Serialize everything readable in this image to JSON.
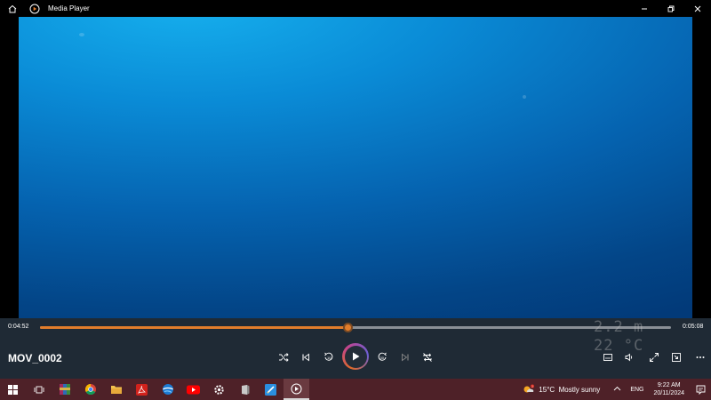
{
  "window": {
    "title": "Media Player"
  },
  "player": {
    "current_time": "0:04:52",
    "total_time": "0:05:08",
    "progress": 0.487,
    "file_name": "MOV_0002",
    "overlay_depth": "2.2 m",
    "overlay_temp": "22 °C"
  },
  "colors": {
    "accent": "#e27d2b",
    "video_top": "#16b0ee",
    "video_bottom": "#023a79",
    "taskbar": "#4e2128"
  },
  "taskbar": {
    "apps": [
      "start-icon",
      "task-view-icon",
      "winrar-icon",
      "chrome-icon",
      "file-explorer-icon",
      "acrobat-icon",
      "browser-icon",
      "youtube-icon",
      "settings-icon",
      "app-icon",
      "drawing-app-icon",
      "media-player-icon"
    ],
    "weather": "15°C  Mostly sunny",
    "weather_badge": "1",
    "language": "ENG",
    "time": "9:22 AM",
    "date": "20/11/2024"
  }
}
